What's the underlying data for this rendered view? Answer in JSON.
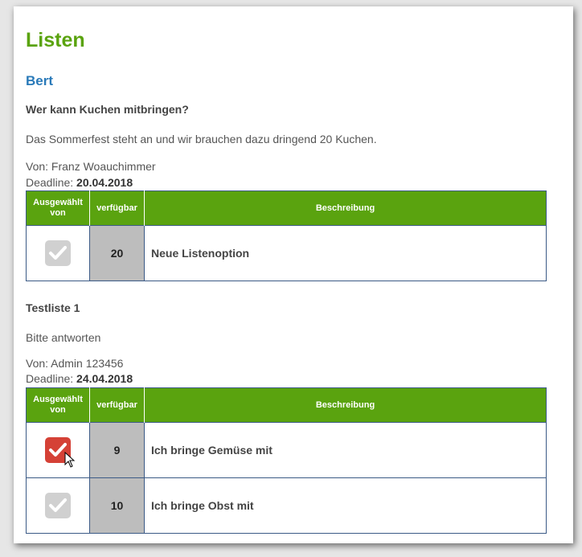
{
  "page": {
    "title": "Listen"
  },
  "user": {
    "name": "Bert"
  },
  "table_headers": {
    "selected_by": "Ausgewählt von",
    "available": "verfügbar",
    "description": "Beschreibung"
  },
  "lists": [
    {
      "title": "Wer kann Kuchen mitbringen?",
      "description": "Das Sommerfest steht an und wir brauchen dazu dringend 20 Kuchen.",
      "from_label": "Von: Franz Woauchimmer",
      "deadline_label": "Deadline:",
      "deadline": "20.04.2018",
      "options": [
        {
          "checked": false,
          "available": "20",
          "description": "Neue Listenoption"
        }
      ]
    },
    {
      "title": "Testliste 1",
      "description": "Bitte antworten",
      "from_label": "Von: Admin 123456",
      "deadline_label": "Deadline:",
      "deadline": "24.04.2018",
      "options": [
        {
          "checked": true,
          "available": "9",
          "description": "Ich bringe Gemüse mit"
        },
        {
          "checked": false,
          "available": "10",
          "description": "Ich bringe Obst mit"
        }
      ]
    }
  ],
  "colors": {
    "accent_green": "#5aa30f",
    "user_blue": "#2a7ab9",
    "checked_red": "#d54136",
    "unchecked_gray": "#d0d0d0"
  },
  "icons": {
    "checkbox": "checkmark-icon",
    "cursor": "mouse-cursor-icon"
  }
}
